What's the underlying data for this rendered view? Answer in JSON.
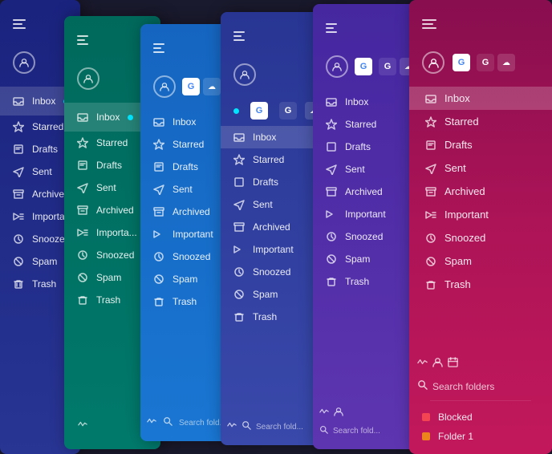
{
  "panels": [
    {
      "id": "panel-1",
      "color": "dark-blue",
      "nav_items": [
        {
          "id": "inbox",
          "label": "Inbox",
          "icon": "inbox",
          "active": true,
          "has_dot": true,
          "has_google": true
        },
        {
          "id": "starred",
          "label": "Starred",
          "icon": "star"
        },
        {
          "id": "drafts",
          "label": "Drafts",
          "icon": "drafts"
        },
        {
          "id": "sent",
          "label": "Sent",
          "icon": "sent"
        },
        {
          "id": "archived",
          "label": "Archived",
          "icon": "archived"
        },
        {
          "id": "important",
          "label": "Important",
          "icon": "important"
        },
        {
          "id": "snoozed",
          "label": "Snoozed",
          "icon": "snoozed"
        },
        {
          "id": "spam",
          "label": "Spam",
          "icon": "spam"
        },
        {
          "id": "trash",
          "label": "Trash",
          "icon": "trash"
        }
      ]
    },
    {
      "id": "panel-2",
      "color": "teal",
      "nav_items": [
        {
          "id": "inbox",
          "label": "Inbox",
          "active": true,
          "has_dot": true,
          "has_google": true
        },
        {
          "id": "starred",
          "label": "Starred"
        },
        {
          "id": "drafts",
          "label": "Drafts"
        },
        {
          "id": "sent",
          "label": "Sent"
        },
        {
          "id": "archived",
          "label": "Archived"
        },
        {
          "id": "important",
          "label": "Importa..."
        },
        {
          "id": "snoozed",
          "label": "Snoozed"
        },
        {
          "id": "spam",
          "label": "Spam"
        },
        {
          "id": "trash",
          "label": "Trash"
        }
      ]
    },
    {
      "id": "panel-3",
      "color": "blue",
      "nav_items": [
        {
          "id": "inbox",
          "label": "Inbox"
        },
        {
          "id": "starred",
          "label": "Starred"
        },
        {
          "id": "drafts",
          "label": "Drafts"
        },
        {
          "id": "sent",
          "label": "Sent"
        },
        {
          "id": "archived",
          "label": "Archived"
        },
        {
          "id": "important",
          "label": "Important"
        },
        {
          "id": "snoozed",
          "label": "Snoozed"
        },
        {
          "id": "spam",
          "label": "Spam"
        },
        {
          "id": "trash",
          "label": "Trash"
        }
      ]
    },
    {
      "id": "panel-4",
      "color": "medium-blue",
      "nav_items": [
        {
          "id": "inbox",
          "label": "Inbox",
          "has_dot": true,
          "has_google": true
        },
        {
          "id": "starred",
          "label": "Starred"
        },
        {
          "id": "drafts",
          "label": "Drafts"
        },
        {
          "id": "sent",
          "label": "Sent"
        },
        {
          "id": "archived",
          "label": "Archived"
        },
        {
          "id": "important",
          "label": "Important"
        },
        {
          "id": "snoozed",
          "label": "Snoozed"
        },
        {
          "id": "spam",
          "label": "Spam"
        },
        {
          "id": "trash",
          "label": "Trash"
        }
      ]
    },
    {
      "id": "panel-5",
      "color": "purple",
      "nav_items": [
        {
          "id": "inbox",
          "label": "Inbox"
        },
        {
          "id": "starred",
          "label": "Starred"
        },
        {
          "id": "drafts",
          "label": "Drafts"
        },
        {
          "id": "sent",
          "label": "Sent"
        },
        {
          "id": "archived",
          "label": "Archived"
        },
        {
          "id": "important",
          "label": "Important"
        },
        {
          "id": "snoozed",
          "label": "Snoozed"
        },
        {
          "id": "spam",
          "label": "Spam"
        },
        {
          "id": "trash",
          "label": "Trash"
        }
      ],
      "bottom": {
        "activity": true,
        "search_folders": "Search fold..."
      }
    },
    {
      "id": "panel-6",
      "color": "pink",
      "nav_items": [
        {
          "id": "inbox",
          "label": "Inbox",
          "active": true
        },
        {
          "id": "starred",
          "label": "Starred"
        },
        {
          "id": "drafts",
          "label": "Drafts"
        },
        {
          "id": "sent",
          "label": "Sent"
        },
        {
          "id": "archived",
          "label": "Archived"
        },
        {
          "id": "important",
          "label": "Important"
        },
        {
          "id": "snoozed",
          "label": "Snoozed"
        },
        {
          "id": "spam",
          "label": "Spam"
        },
        {
          "id": "trash",
          "label": "Trash"
        }
      ],
      "bottom": {
        "activity": true,
        "search_folders": "Search folders",
        "blocked": "Blocked",
        "folder_1": "Folder 1"
      }
    }
  ],
  "icons": {
    "inbox": "⬛",
    "star": "★",
    "drafts": "📄",
    "sent": "➤",
    "archive": "🗄",
    "important": "⚑",
    "snoozed": "⏰",
    "spam": "⊘",
    "trash": "🗑"
  }
}
